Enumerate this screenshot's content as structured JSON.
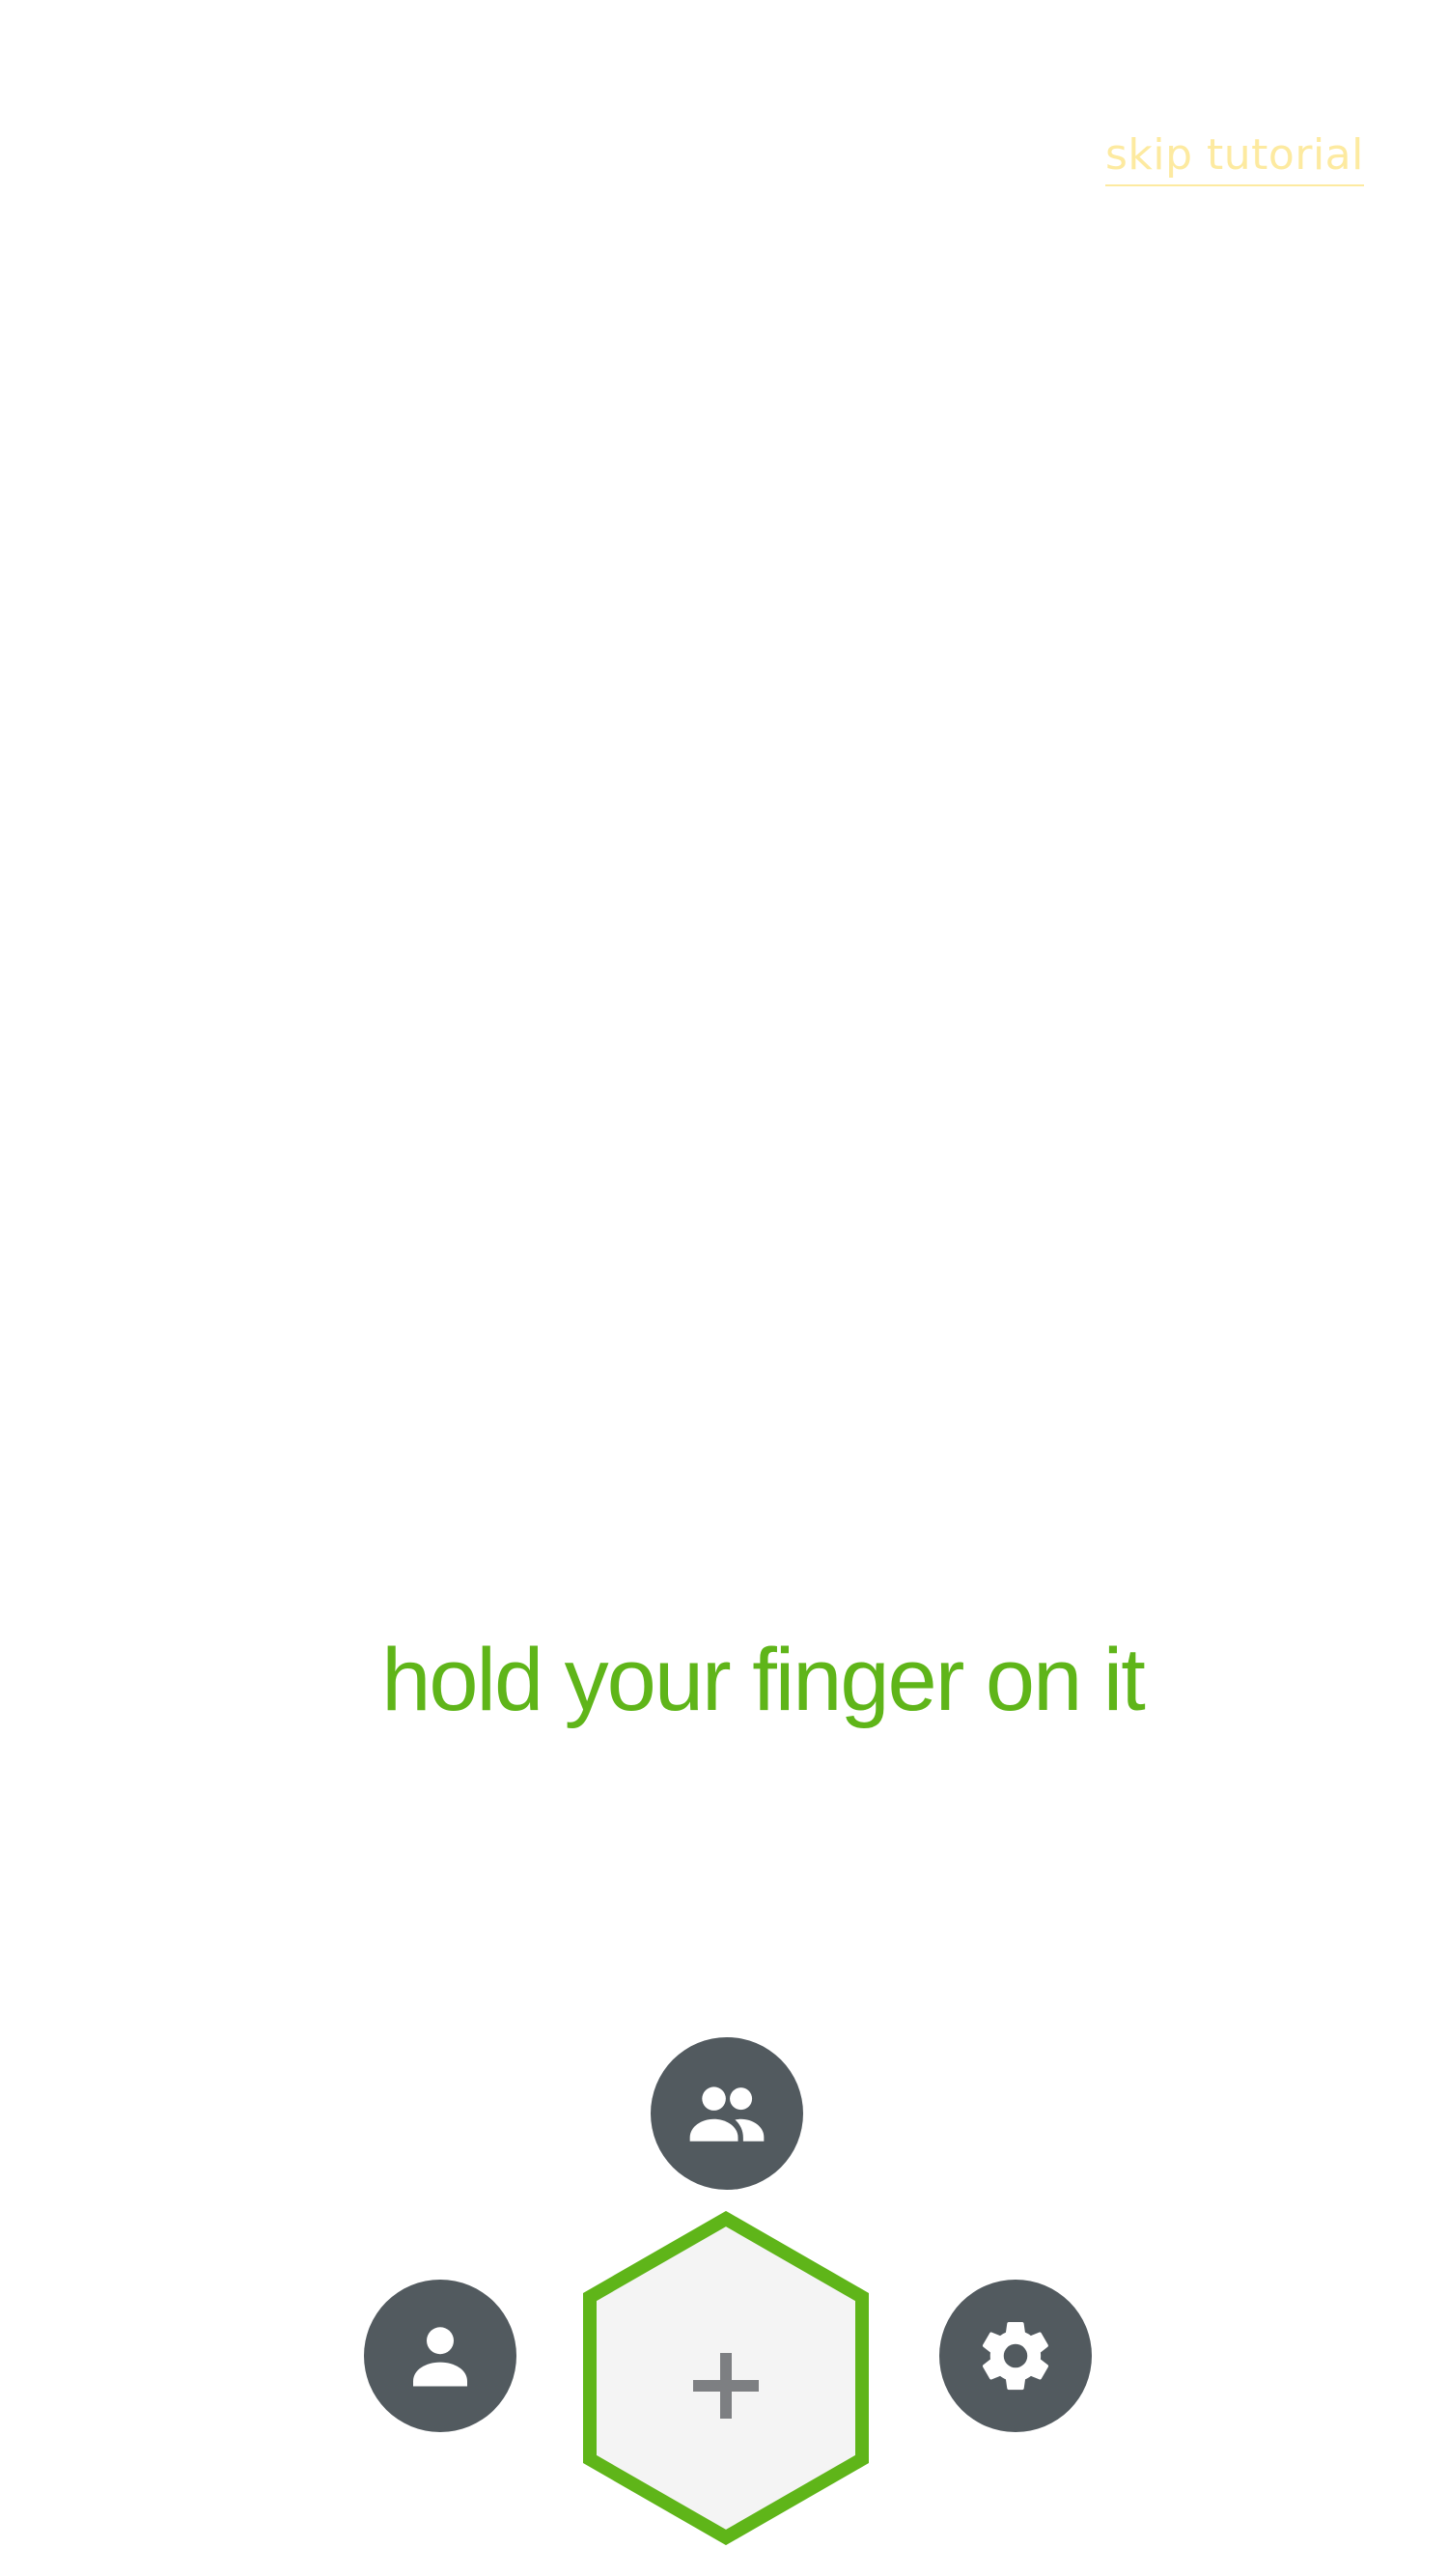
{
  "tutorial": {
    "skip_label": "skip tutorial",
    "instruction": "hold your finger on it"
  },
  "menu": {
    "top_icon": "groups-icon",
    "left_icon": "person-icon",
    "right_icon": "gear-icon",
    "center_icon": "plus-icon"
  },
  "colors": {
    "accent_green": "#5fb519",
    "skip_yellow": "#fdeaa0",
    "button_dark": "#525a5f",
    "hex_fill": "#f4f4f4",
    "plus_gray": "#7d7f82"
  }
}
